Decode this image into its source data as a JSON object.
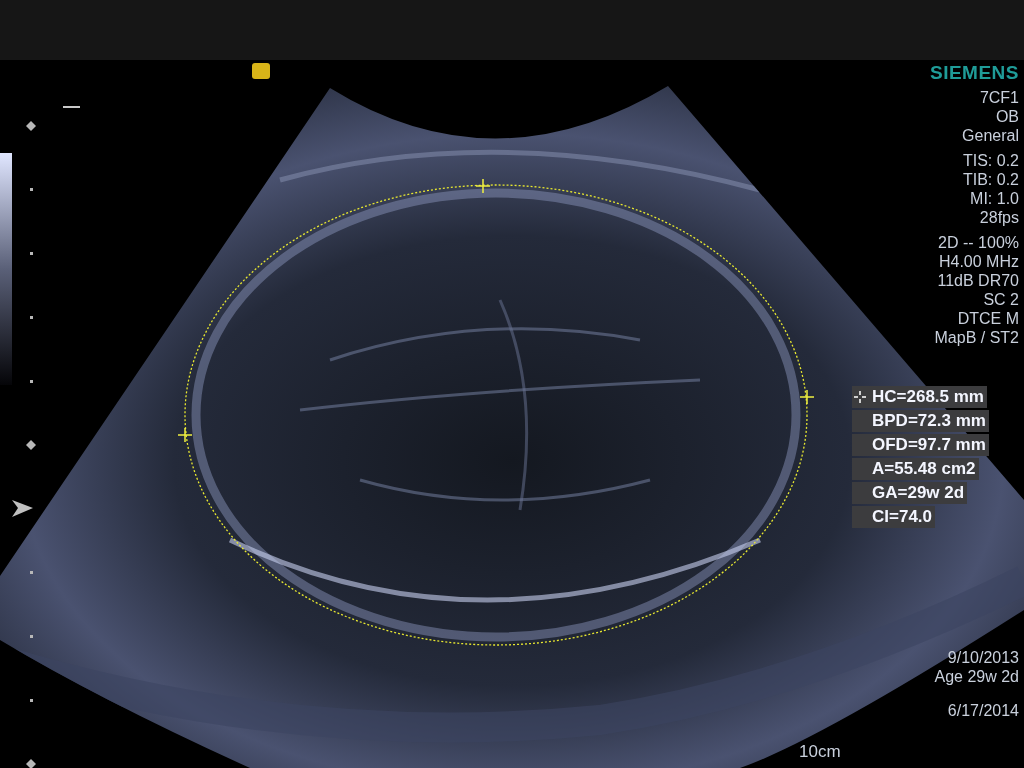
{
  "brand": "SIEMENS",
  "info_groups": [
    [
      "7CF1",
      "OB",
      "General"
    ],
    [
      "TIS: 0.2",
      "TIB: 0.2",
      "MI: 1.0",
      "28fps"
    ],
    [
      "2D -- 100%",
      "H4.00 MHz",
      "11dB DR70",
      "SC 2",
      "DTCE M",
      "MapB / ST2"
    ]
  ],
  "measurements": [
    "HC=268.5 mm",
    "BPD=72.3 mm",
    "OFD=97.7 mm",
    "A=55.48 cm2",
    "GA=29w 2d",
    "CI=74.0"
  ],
  "dates": [
    "9/10/2013",
    "Age 29w 2d"
  ],
  "exam_date": "6/17/2014",
  "depth": "10cm"
}
